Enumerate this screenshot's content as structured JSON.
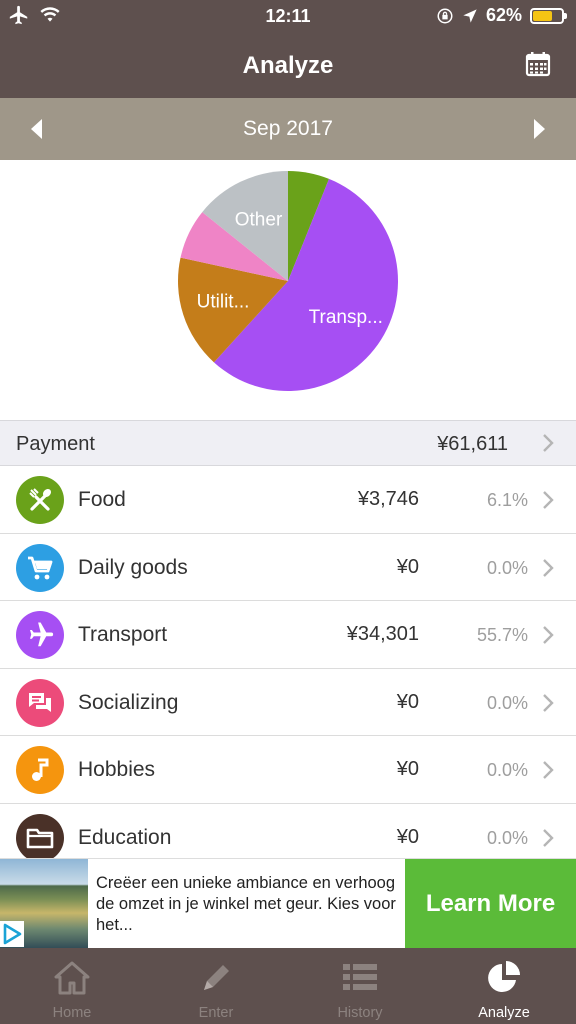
{
  "status_bar": {
    "time": "12:11",
    "battery": "62%",
    "battery_level": 0.62
  },
  "nav": {
    "title": "Analyze",
    "calendar_icon": "calendar-icon"
  },
  "month": {
    "label": "Sep 2017"
  },
  "chart_data": {
    "type": "pie",
    "slices": [
      {
        "label": "",
        "value": 3746,
        "color": "#6aa21a"
      },
      {
        "label": "Transp...",
        "value": 34301,
        "color": "#a64ff3"
      },
      {
        "label": "Utilit...",
        "value": 10260,
        "color": "#c47d1a"
      },
      {
        "label": "",
        "value": 4540,
        "color": "#ef84c6"
      },
      {
        "label": "Other",
        "value": 8764,
        "color": "#bcc1c5"
      }
    ]
  },
  "payment": {
    "label": "Payment",
    "amount": "¥61,611"
  },
  "categories": [
    {
      "name": "Food",
      "amount": "¥3,746",
      "pct": "6.1%",
      "color": "#6aa21a",
      "icon": "fork-knife-icon"
    },
    {
      "name": "Daily goods",
      "amount": "¥0",
      "pct": "0.0%",
      "color": "#2d9fe3",
      "icon": "cart-icon"
    },
    {
      "name": "Transport",
      "amount": "¥34,301",
      "pct": "55.7%",
      "color": "#a64ff3",
      "icon": "airplane-icon"
    },
    {
      "name": "Socializing",
      "amount": "¥0",
      "pct": "0.0%",
      "color": "#ec4b7a",
      "icon": "chat-icon"
    },
    {
      "name": "Hobbies",
      "amount": "¥0",
      "pct": "0.0%",
      "color": "#f5950e",
      "icon": "music-note-icon"
    },
    {
      "name": "Education",
      "amount": "¥0",
      "pct": "0.0%",
      "color": "#4a3128",
      "icon": "folder-icon"
    }
  ],
  "ad": {
    "text": "Creëer een unieke ambiance en verhoog de omzet in je winkel met geur. Kies voor het...",
    "cta": "Learn More"
  },
  "tabs": [
    {
      "label": "Home",
      "icon": "home-icon",
      "active": false
    },
    {
      "label": "Enter",
      "icon": "pencil-icon",
      "active": false
    },
    {
      "label": "History",
      "icon": "list-icon",
      "active": false
    },
    {
      "label": "Analyze",
      "icon": "pie-chart-icon",
      "active": true
    }
  ]
}
